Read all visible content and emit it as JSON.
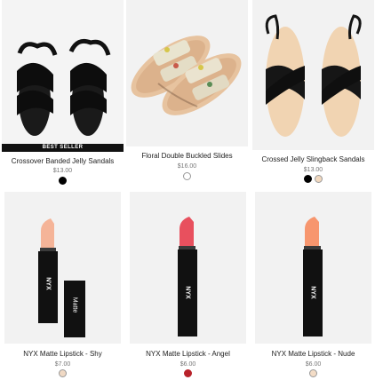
{
  "products": [
    {
      "name": "Crossover Banded Jelly Sandals",
      "price": "$13.00",
      "badge": "BEST SELLER",
      "swatches": [
        "#000000"
      ]
    },
    {
      "name": "Floral Double Buckled Slides",
      "price": "$16.00",
      "swatches": [
        "#ffffff"
      ]
    },
    {
      "name": "Crossed Jelly Slingback Sandals",
      "price": "$13.00",
      "swatches": [
        "#000000",
        "#f2d9bf"
      ]
    },
    {
      "name": "NYX Matte Lipstick - Shy",
      "price": "$7.00",
      "swatches": [
        "#f0d9c4"
      ]
    },
    {
      "name": "NYX Matte Lipstick - Angel",
      "price": "$6.00",
      "swatches": [
        "#b8222a"
      ]
    },
    {
      "name": "NYX Matte Lipstick - Nude",
      "price": "$6.00",
      "swatches": [
        "#f3dcc6"
      ]
    }
  ],
  "lipstick_brand": "NYX",
  "lipstick_cap_text": "Matte",
  "lipstick_cap_subtext": "LIPSTICK",
  "colors": {
    "card_bg": "#f2f2f2",
    "shy_bullet": "#f5b498",
    "angel_bullet": "#e8505e",
    "nude_bullet": "#f7966e"
  }
}
